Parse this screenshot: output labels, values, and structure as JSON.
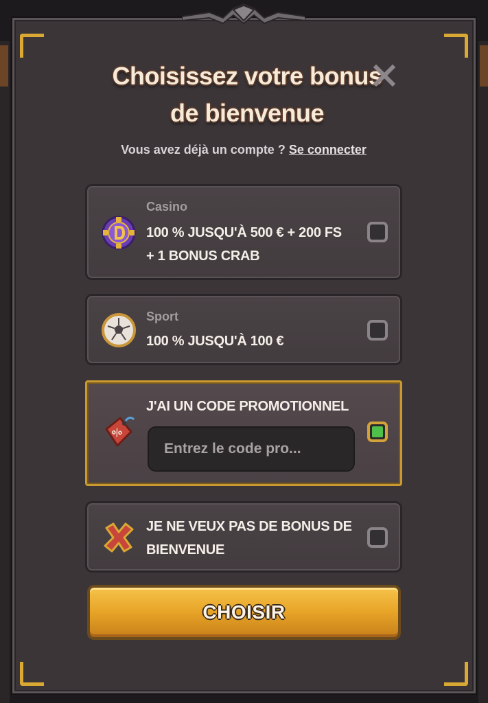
{
  "modal": {
    "title": "Choisissez votre bonus de bienvenue",
    "close_icon": "close-icon",
    "login_prompt": "Vous avez déjà un compte ?",
    "login_link": "Se connecter"
  },
  "options": [
    {
      "id": "casino",
      "label": "Casino",
      "text_line1": "100 % JUSQU'À 500 € + 200 FS",
      "text_line2": "+ 1 BONUS CRAB",
      "icon": "casino-chip-icon",
      "checked": false
    },
    {
      "id": "sport",
      "label": "Sport",
      "text_line1": "100 % JUSQU'À 100 €",
      "icon": "soccer-ball-icon",
      "checked": false
    },
    {
      "id": "promo",
      "text_line1": "J'AI UN CODE PROMOTIONNEL",
      "input_placeholder": "Entrez le code pro...",
      "icon": "price-tag-icon",
      "checked": true
    },
    {
      "id": "no-bonus",
      "text_line1": "JE NE VEUX PAS DE BONUS DE",
      "text_line2": "BIENVENUE",
      "icon": "red-x-icon",
      "checked": false
    }
  ],
  "submit_label": "CHOISIR",
  "colors": {
    "accent_gold": "#d9a933",
    "checked_green": "#4fc04a",
    "panel_bg": "#3b3538"
  }
}
